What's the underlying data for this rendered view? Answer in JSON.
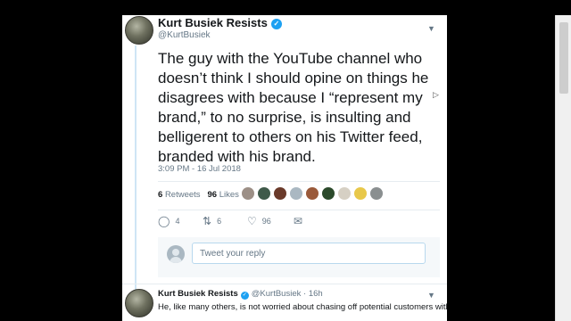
{
  "tweet": {
    "author_name": "Kurt Busiek Resists",
    "verified_mark": "✓",
    "handle": "@KurtBusiek",
    "text": "The guy with the YouTube channel who doesn’t think I should opine on things he disagrees with because I “represent my brand,” to no surprise, is insulting and belligerent to others on his Twitter feed, branded with his brand.",
    "timestamp": "3:09 PM - 16 Jul 2018",
    "retweets_count": "6",
    "retweets_label": "Retweets",
    "likes_count": "96",
    "likes_label": "Likes"
  },
  "likers": [
    {
      "color": "#9c8f86"
    },
    {
      "color": "#3f5a4a"
    },
    {
      "color": "#6a3a2a"
    },
    {
      "color": "#aab8c2"
    },
    {
      "color": "#9a5a3a"
    },
    {
      "color": "#2b4a2b"
    },
    {
      "color": "#d6d0c4"
    },
    {
      "color": "#e8c84a"
    },
    {
      "color": "#8a8f90"
    }
  ],
  "actions": {
    "reply_count": "4",
    "retweet_count": "6",
    "like_count": "96",
    "reply_icon": "reply-icon",
    "retweet_icon": "retweet-icon",
    "like_icon": "heart-icon",
    "message_icon": "envelope-icon"
  },
  "reply": {
    "placeholder": "Tweet your reply"
  },
  "next_tweet": {
    "author_name": "Kurt Busiek Resists",
    "verified_mark": "✓",
    "handle": "@KurtBusiek",
    "separator": "·",
    "age": "16h",
    "text": "He, like many others, is not worried about chasing off potential customers with"
  },
  "colors": {
    "accent": "#1da1f2",
    "text": "#14171a",
    "muted": "#657786",
    "thread_line": "#cfe5f5"
  }
}
